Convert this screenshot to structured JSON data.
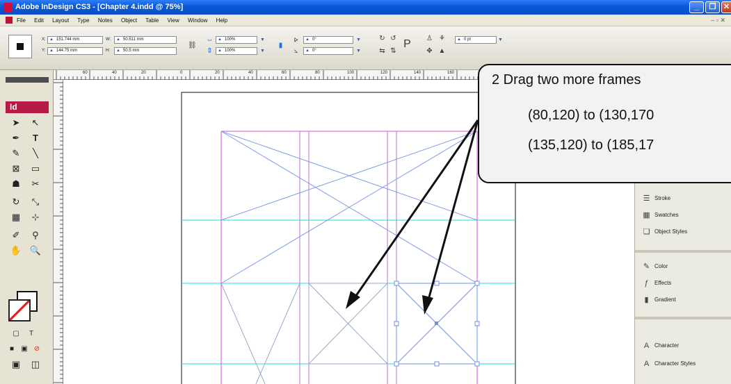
{
  "window": {
    "title": "Adobe InDesign CS3 - [Chapter 4.indd @ 75%]"
  },
  "menu": [
    "File",
    "Edit",
    "Layout",
    "Type",
    "Notes",
    "Object",
    "Table",
    "View",
    "Window",
    "Help"
  ],
  "control_panel": {
    "x_label": "X:",
    "x_value": "151.744 mm",
    "y_label": "Y:",
    "y_value": "144.75 mm",
    "w_label": "W:",
    "w_value": "50.511 mm",
    "h_label": "H:",
    "h_value": "50.5 mm",
    "scale_x": "100%",
    "scale_y": "100%",
    "rotate": "0°",
    "shear": "0°",
    "stroke_weight": "0 pt"
  },
  "tools": {
    "logo": "Id"
  },
  "ruler": {
    "labels": [
      "60",
      "40",
      "20",
      "0",
      "20",
      "40",
      "60",
      "80",
      "100",
      "120",
      "140",
      "160"
    ]
  },
  "panels": {
    "items": [
      {
        "label": "Stroke",
        "icon": "stroke-icon"
      },
      {
        "label": "Swatches",
        "icon": "swatches-icon"
      },
      {
        "label": "Object Styles",
        "icon": "object-styles-icon"
      },
      {
        "label": "Color",
        "icon": "color-icon"
      },
      {
        "label": "Effects",
        "icon": "effects-icon"
      },
      {
        "label": "Gradient",
        "icon": "gradient-icon"
      },
      {
        "label": "Character",
        "icon": "character-icon"
      },
      {
        "label": "Character Styles",
        "icon": "character-styles-icon"
      }
    ]
  },
  "callout": {
    "step": "2  Drag two more frames",
    "coord1": "(80,120) to (130,170",
    "coord2": "(135,120) to (185,17"
  },
  "colors": {
    "title_bar": "#0a58d8",
    "margin_guide": "#d64fd8",
    "column_guide": "#b07ad0",
    "ruler_guide": "#19e0e6",
    "frame_line": "#6f8fe0",
    "logo": "#b51a46"
  }
}
